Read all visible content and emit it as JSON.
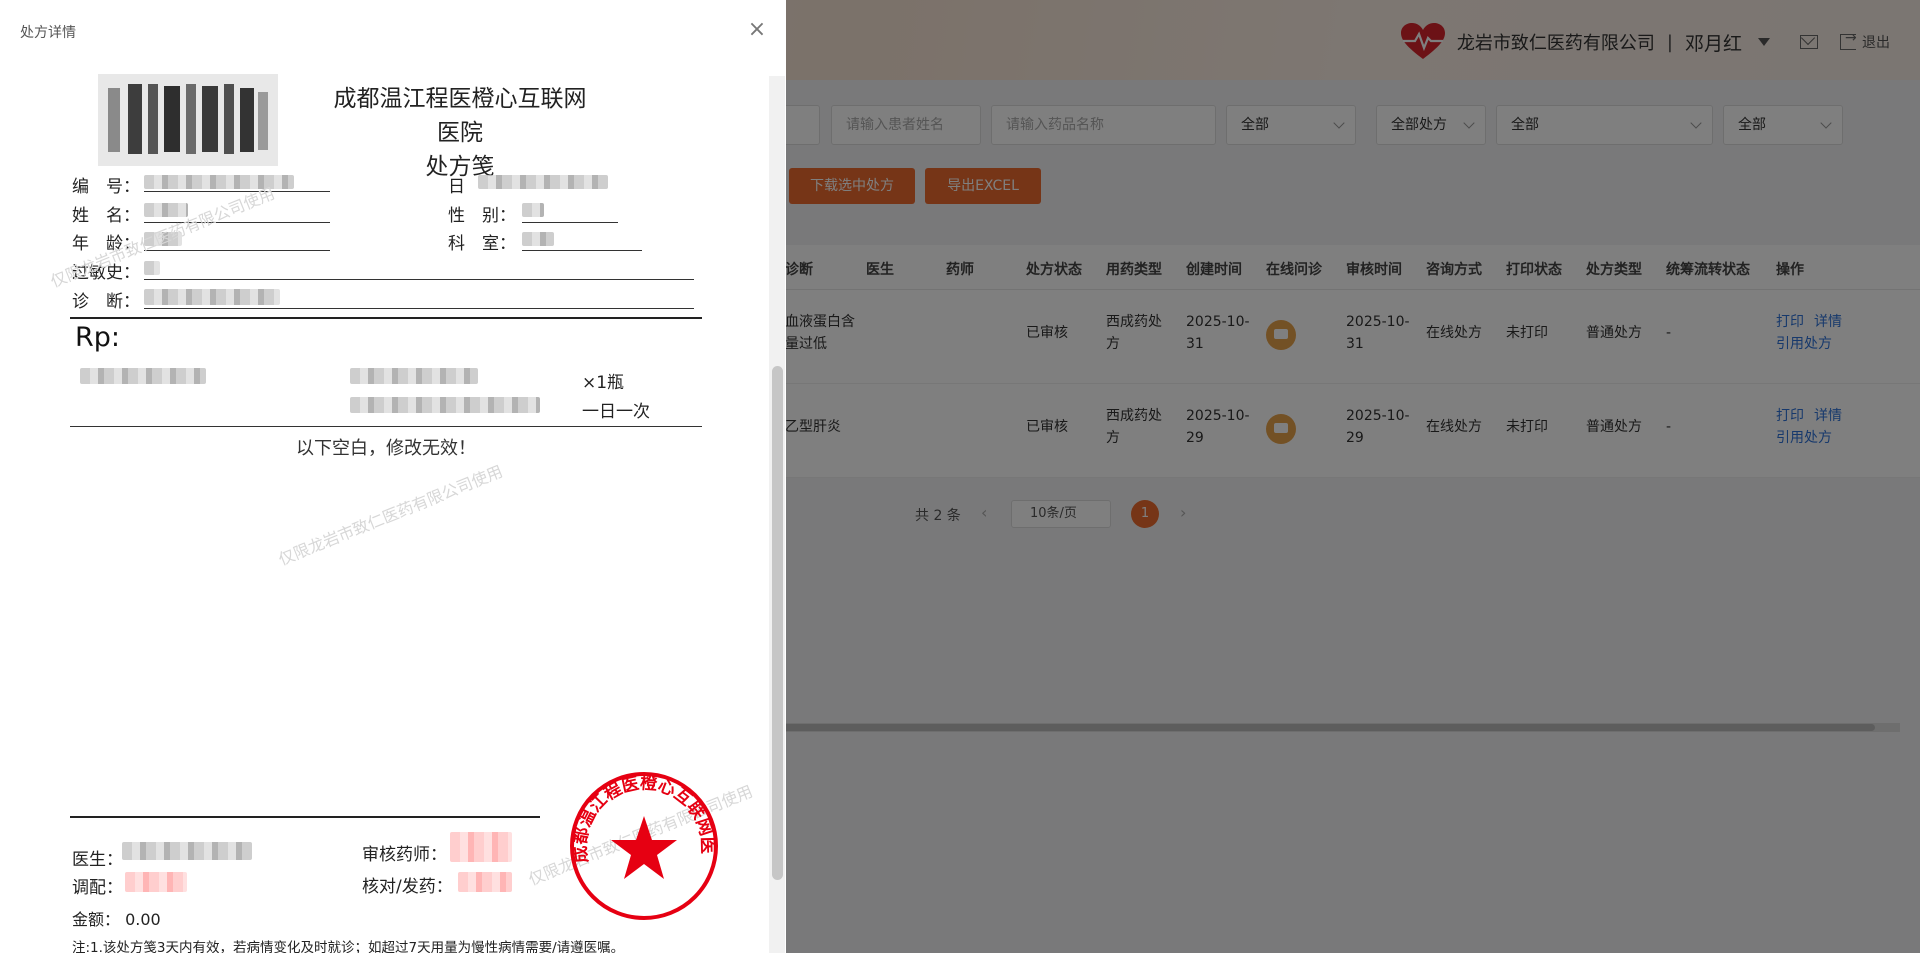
{
  "header": {
    "company": "龙岩市致仁医药有限公司",
    "separator": "|",
    "user": "邓月红",
    "logout": "退出"
  },
  "filters": {
    "patient_placeholder": "请输入患者姓名",
    "drug_placeholder": "请输入药品名称",
    "select1": "全部",
    "select2": "全部处方",
    "select3": "全部",
    "select4": "全部"
  },
  "actions": {
    "download": "下载选中处方",
    "export": "导出EXCEL"
  },
  "table": {
    "headers": [
      "诊断",
      "医生",
      "药师",
      "处方状态",
      "用药类型",
      "创建时间",
      "在线问诊",
      "审核时间",
      "咨询方式",
      "打印状态",
      "处方类型",
      "统筹流转状态",
      "操作"
    ],
    "rows": [
      {
        "diagnosis": "血液蛋白含量过低",
        "status": "已审核",
        "drug_type": "西成药处方",
        "created": "2025-10-31",
        "reviewed": "2025-10-31",
        "consult": "在线处方",
        "print": "未打印",
        "rx_type": "普通处方",
        "flow": "-",
        "op_print": "打印",
        "op_detail": "详情",
        "op_ref": "引用处方"
      },
      {
        "diagnosis": "乙型肝炎",
        "status": "已审核",
        "drug_type": "西成药处方",
        "created": "2025-10-29",
        "reviewed": "2025-10-29",
        "consult": "在线处方",
        "print": "未打印",
        "rx_type": "普通处方",
        "flow": "-",
        "op_print": "打印",
        "op_detail": "详情",
        "op_ref": "引用处方"
      }
    ]
  },
  "pagination": {
    "total": "共 2 条",
    "page_size": "10条/页",
    "current": "1"
  },
  "drawer": {
    "title": "处方详情",
    "close": "×",
    "hospital": "成都温江程医橙心互联网医院",
    "doc_type": "处方笺",
    "labels": {
      "no": "编　号：",
      "date": "日",
      "name": "姓　名：",
      "gender": "性　别：",
      "age": "年　龄：",
      "dept": "科　室：",
      "allergy": "过敏史：",
      "diag": "诊　断："
    },
    "rp": "Rp:",
    "qty": "×1瓶",
    "freq": "一日一次",
    "blank_note": "以下空白，修改无效！",
    "watermark": "仅限龙岩市致仁医药有限公司使用",
    "seal_text": "成都温江程医橙心互联网医院",
    "doctor": "医生：",
    "pharmacist": "审核药师：",
    "dispense": "调配：",
    "check": "核对/发药：",
    "amount_label": "金额：",
    "amount_value": "0.00",
    "footnote": "注:1.该处方笺3天内有效，若病情变化及时就诊；如超过7天用量为慢性病情需要/请遵医嘱。"
  },
  "colors": {
    "accent": "#ec6a2e",
    "link": "#2f73d8",
    "seal": "#e60012",
    "overlay": "rgba(0,0,0,0.5)"
  },
  "icons": [
    "heart-logo-icon",
    "caret-down-icon",
    "mail-icon",
    "logout-icon",
    "chat-icon",
    "close-icon",
    "star-icon"
  ]
}
